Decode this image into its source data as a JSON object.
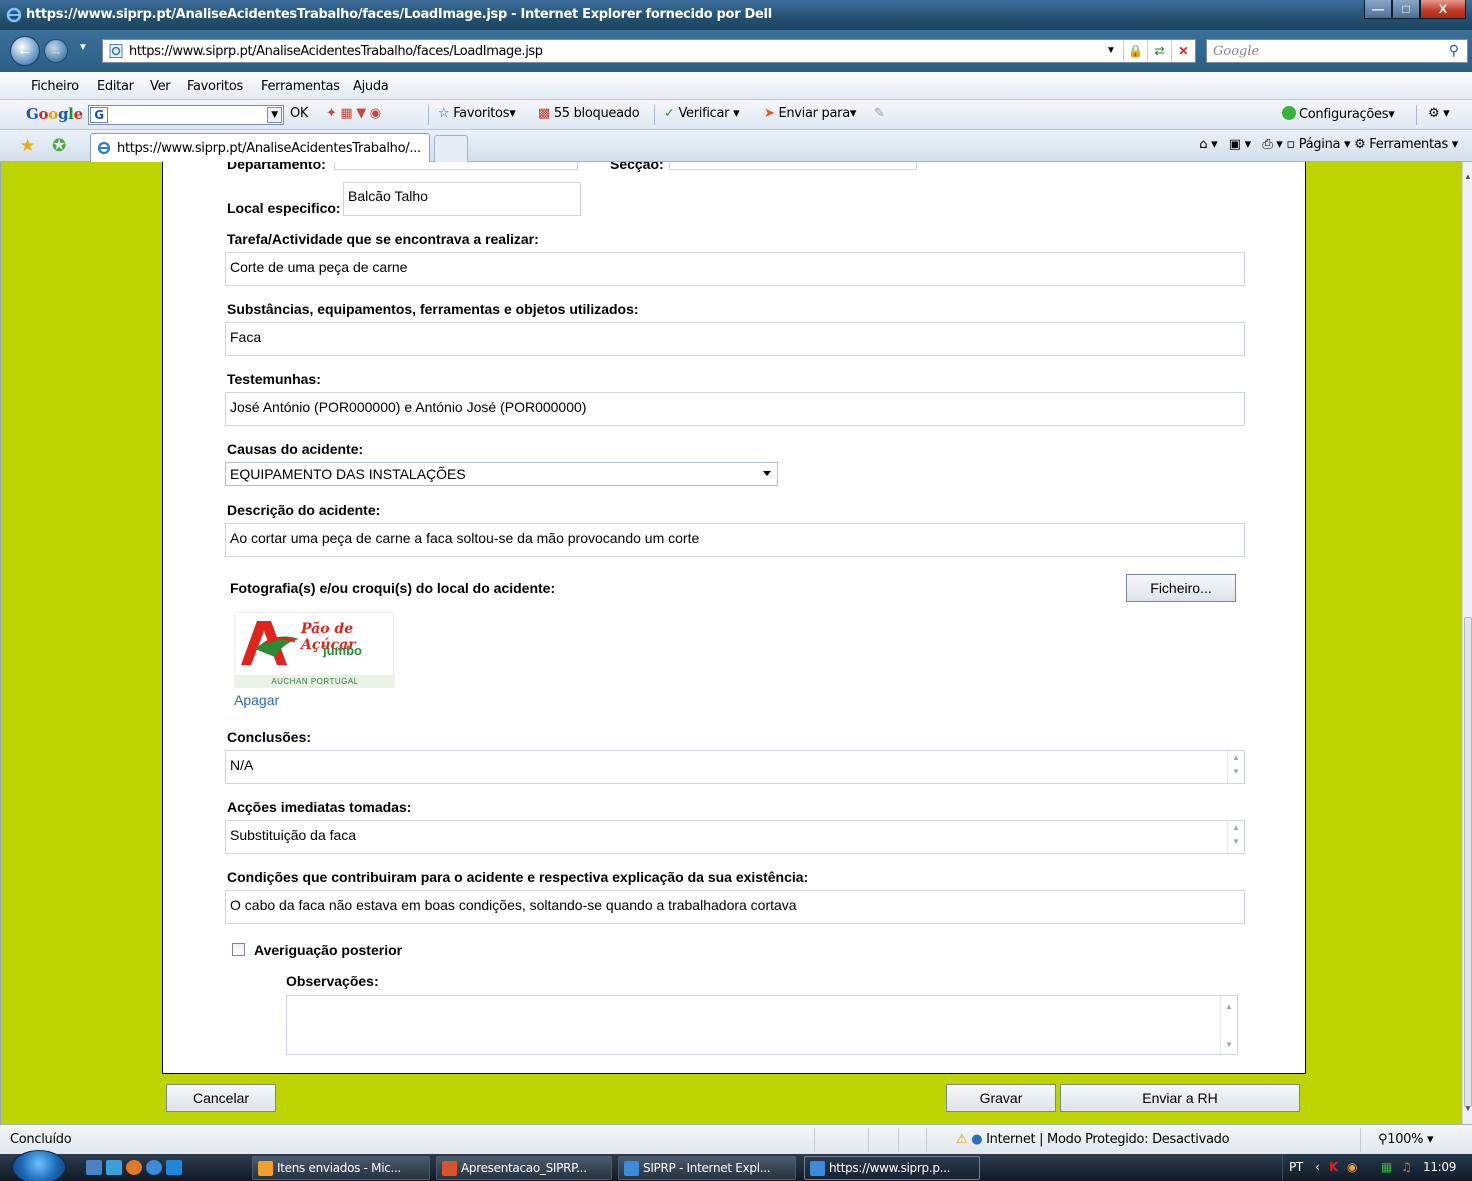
{
  "browser": {
    "window_title": "https://www.siprp.pt/AnaliseAcidentesTrabalho/faces/LoadImage.jsp - Internet Explorer fornecido por Dell",
    "address": "https://www.siprp.pt/AnaliseAcidentesTrabalho/faces/LoadImage.jsp",
    "search_placeholder": "Google",
    "menu": [
      "Ficheiro",
      "Editar",
      "Ver",
      "Favoritos",
      "Ferramentas",
      "Ajuda"
    ],
    "google_toolbar": {
      "logo": "Google",
      "ok": "OK",
      "favoritos": "Favoritos",
      "bloqueado": "55 bloqueado",
      "verificar": "Verificar",
      "enviar_para": "Enviar para",
      "configuracoes": "Configurações"
    },
    "tab_title": "https://www.siprp.pt/AnaliseAcidentesTrabalho/...",
    "command_bar": {
      "pagina": "Página",
      "ferramentas": "Ferramentas"
    },
    "status": {
      "left": "Concluído",
      "zone": "Internet | Modo Protegido: Desactivado",
      "zoom": "100%"
    }
  },
  "taskbar": {
    "tasks": [
      "Itens enviados - Mic...",
      "Apresentacao_SIPRP...",
      "SIPRP - Internet Expl...",
      "https://www.siprp.p..."
    ],
    "lang": "PT",
    "clock": "11:09"
  },
  "form": {
    "departamento_label": "Departamento:",
    "seccao_label": "Secção:",
    "local_label": "Local especifico:",
    "local_value": "Balcão Talho",
    "tarefa_label": "Tarefa/Actividade que se encontrava a realizar:",
    "tarefa_value": "Corte de uma peça de carne",
    "substancias_label": "Substâncias, equipamentos, ferramentas e objetos utilizados:",
    "substancias_value": "Faca",
    "testemunhas_label": "Testemunhas:",
    "testemunhas_value": "José António (POR000000) e António José (POR000000)",
    "causas_label": "Causas do acidente:",
    "causas_value": "EQUIPAMENTO DAS INSTALAÇÕES",
    "descricao_label": "Descrição do acidente:",
    "descricao_value": "Ao cortar uma peça de carne a faca soltou-se da mão provocando um corte",
    "fotografia_label": "Fotografia(s) e/ou croqui(s) do local do acidente:",
    "ficheiro_button": "Ficheiro...",
    "logo_text": {
      "line1": "Pão de Açúcar",
      "line2": "jumbo",
      "line3": "AUCHAN PORTUGAL"
    },
    "apagar_link": "Apagar",
    "conclusoes_label": "Conclusões:",
    "conclusoes_value": "N/A",
    "accoes_label": "Acções imediatas tomadas:",
    "accoes_value": "Substituição da faca",
    "condicoes_label": "Condições que contribuiram para o acidente e respectiva explicação da sua existência:",
    "condicoes_value": "O cabo da faca não estava em boas condições, soltando-se quando a trabalhadora cortava",
    "averiguacao_label": "Averiguação posterior",
    "averiguacao_checked": false,
    "observacoes_label": "Observações:",
    "observacoes_value": ""
  },
  "actions": {
    "cancelar": "Cancelar",
    "gravar": "Gravar",
    "enviar_rh": "Enviar a RH"
  },
  "colors": {
    "page_background": "#bcd400",
    "link": "#2a69b5"
  }
}
